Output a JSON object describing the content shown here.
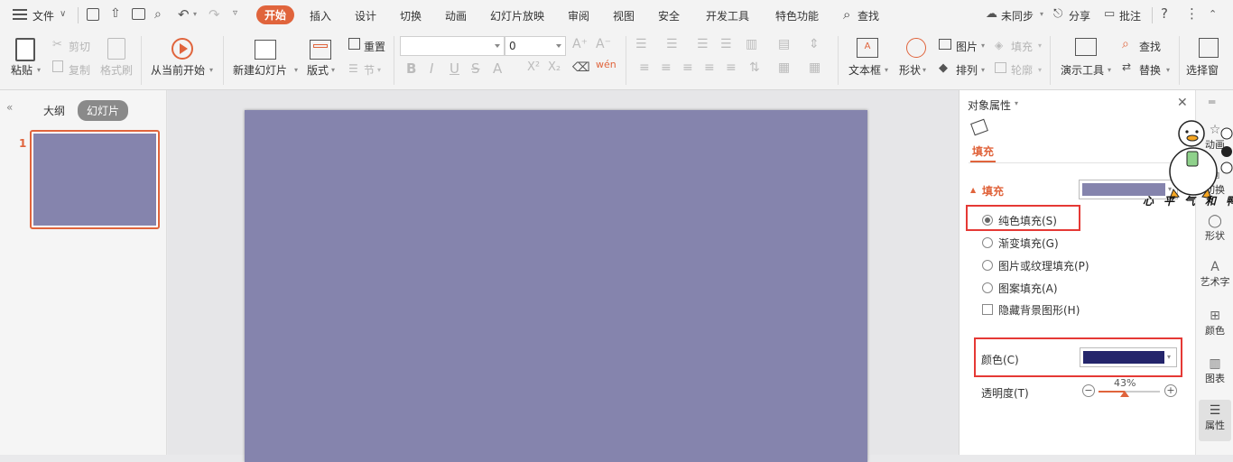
{
  "menubar": {
    "file_label": "文件",
    "tabs": [
      "开始",
      "插入",
      "设计",
      "切换",
      "动画",
      "幻灯片放映",
      "审阅",
      "视图",
      "安全",
      "开发工具",
      "特色功能"
    ],
    "active_tab": "开始",
    "search_label": "查找",
    "sync_label": "未同步",
    "share_label": "分享",
    "comment_label": "批注"
  },
  "ribbon": {
    "paste": "粘贴",
    "cut": "剪切",
    "copy": "复制",
    "format_painter": "格式刷",
    "play_from_current": "从当前开始",
    "new_slide": "新建幻灯片",
    "layout": "版式",
    "reset": "重置",
    "section": "节",
    "font_size_value": "0",
    "font_name_value": "",
    "textbox": "文本框",
    "shape": "形状",
    "picture": "图片",
    "arrange": "排列",
    "fill": "填充",
    "outline": "轮廓",
    "presentation_tools": "演示工具",
    "find": "查找",
    "replace": "替换",
    "select_pane": "选择窗"
  },
  "leftpanel": {
    "outline_tab": "大纲",
    "slides_tab": "幻灯片",
    "slide_number": "1"
  },
  "properties": {
    "title": "对象属性",
    "fill_tab": "填充",
    "fill_section": "填充",
    "options": [
      {
        "label": "纯色填充(S)",
        "selected": true
      },
      {
        "label": "渐变填充(G)",
        "selected": false
      },
      {
        "label": "图片或纹理填充(P)",
        "selected": false
      },
      {
        "label": "图案填充(A)",
        "selected": false
      }
    ],
    "hide_bg_label": "隐藏背景图形(H)",
    "color_label": "颜色(C)",
    "transparency_label": "透明度(T)",
    "transparency_value": "43%",
    "transparency_fraction": 0.43,
    "fill_swatch_color": "#8584ad",
    "color_swatch_color": "#24256b"
  },
  "sidebar": {
    "items": [
      "动画",
      "切换",
      "形状",
      "艺术字",
      "颜色",
      "图表",
      "属性"
    ]
  },
  "watermark_text": "心平气和鸭",
  "colors": {
    "accent": "#e0643c",
    "slide_bg": "#8584ad",
    "highlight_box": "#e53935"
  }
}
